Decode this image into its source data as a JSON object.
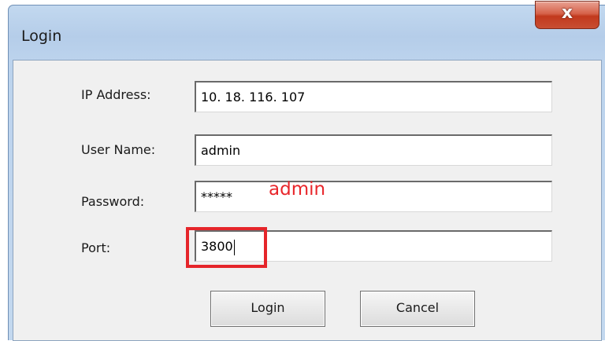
{
  "dialog": {
    "title": "Login",
    "close_icon_glyph": "x"
  },
  "form": {
    "ip_label": "IP Address:",
    "ip_value": "10. 18. 116. 107",
    "user_label": "User Name:",
    "user_value": "admin",
    "password_label": "Password:",
    "password_value": "*****",
    "port_label": "Port:",
    "port_value": "3800"
  },
  "buttons": {
    "login_label": "Login",
    "cancel_label": "Cancel"
  },
  "annotations": {
    "password_hint": "admin",
    "hint_color": "#e8262b",
    "highlight_color": "#e5252a"
  }
}
